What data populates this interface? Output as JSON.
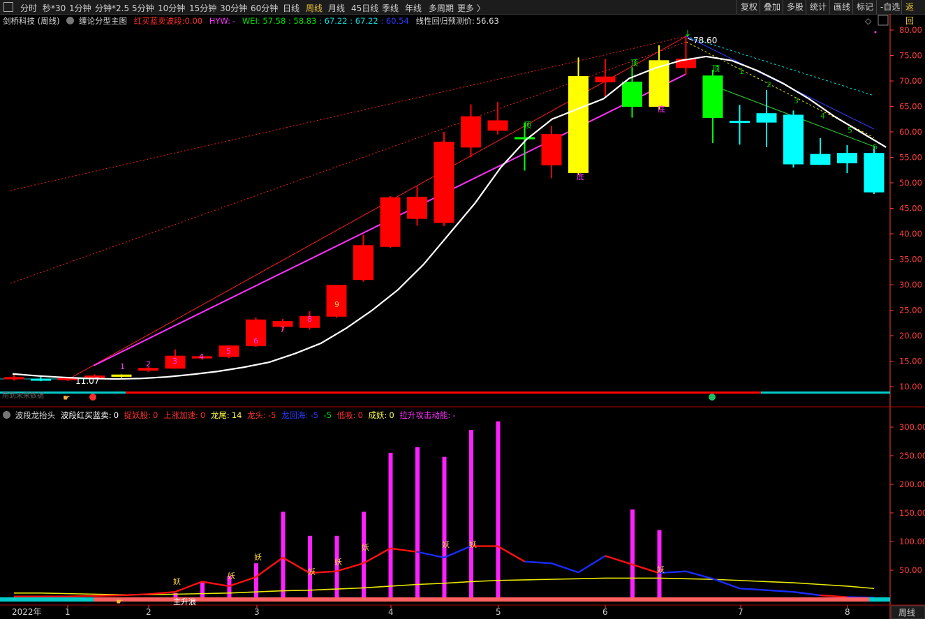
{
  "toolbar": {
    "items": [
      "分时",
      "秒*30",
      "1分钟",
      "分钟*2.5",
      "5分钟",
      "10分钟",
      "15分钟",
      "30分钟",
      "60分钟",
      "日线",
      "周线",
      "月线",
      "45日线",
      "季线",
      "年线",
      "多周期",
      "更多 〉"
    ],
    "active": "周线",
    "right": [
      "复权",
      "叠加",
      "多股",
      "统计",
      "画线",
      "标记",
      "-自选",
      "返回"
    ]
  },
  "main_legend": {
    "stock": "剑桥科技 (周线)",
    "indicator": "缠论分型主图",
    "hmm_label": "红买蓝卖波段:",
    "hmm_value": "0.00",
    "hyw_label": "HYW:",
    "hyw_value": "-",
    "wei_label": "WEI:",
    "wei_v1": "57.58",
    "wei_v2": "58.83",
    "wei_v3": "67.22",
    "wei_v4": "67.22",
    "wei_v5": "60.54",
    "reg_label": "线性回归预测价:",
    "reg_value": "56.63"
  },
  "sub_legend": {
    "indicator": "波段龙抬头",
    "a_label": "波段红买蓝卖:",
    "a_value": "0",
    "b_label": "捉妖股:",
    "b_value": "0",
    "c_label": "上涨加速:",
    "c_value": "0",
    "d_label": "龙尾:",
    "d_value": "14",
    "e_label": "龙头:",
    "e_value": "-5",
    "f_label": "龙回海:",
    "f_value": "-5",
    "g_label": "-5",
    "h_label": "低吸:",
    "h_value": "0",
    "i_label": "成妖:",
    "i_value": "0",
    "j_label": "拉升攻击动能:",
    "j_value": "-"
  },
  "annotations": {
    "max_price": "78.60",
    "min_price": "11.07",
    "top_text": "顶",
    "bottom_text": "底",
    "yao_text": "妖",
    "main_wave": "主升浪",
    "bottom_strip": "用到未来数据"
  },
  "xaxis": {
    "year": "2022年",
    "months": [
      "1",
      "2",
      "3",
      "4",
      "5",
      "6",
      "7",
      "8"
    ],
    "period_button": "周线"
  },
  "colors": {
    "up": "#ff0000",
    "down": "#00ff00",
    "yellow": "#ffff00",
    "cyan": "#00ffff",
    "magenta": "#ff00ff",
    "white": "#ffffff",
    "axis": "#ff3b3b"
  },
  "chart_data": [
    {
      "type": "candlestick",
      "title": "剑桥科技 (周线)",
      "ylim": [
        8,
        82
      ],
      "yticks": [
        10,
        15,
        20,
        25,
        30,
        35,
        40,
        45,
        50,
        55,
        60,
        65,
        70,
        75,
        80
      ],
      "candles": [
        {
          "o": 11.8,
          "h": 12.3,
          "l": 11.2,
          "c": 11.5,
          "color": "up"
        },
        {
          "o": 11.5,
          "h": 11.9,
          "l": 11.07,
          "c": 11.3,
          "color": "cyan"
        },
        {
          "o": 11.3,
          "h": 11.8,
          "l": 11.1,
          "c": 11.6,
          "color": "up"
        },
        {
          "o": 11.6,
          "h": 12.4,
          "l": 11.5,
          "c": 12.1,
          "color": "up"
        },
        {
          "o": 12.0,
          "h": 12.4,
          "l": 11.8,
          "c": 12.3,
          "color": "yellow"
        },
        {
          "o": 13.2,
          "h": 13.9,
          "l": 12.9,
          "c": 13.6,
          "color": "up"
        },
        {
          "o": 13.6,
          "h": 17.3,
          "l": 13.5,
          "c": 16.0,
          "color": "up"
        },
        {
          "o": 15.6,
          "h": 16.3,
          "l": 15.3,
          "c": 15.9,
          "color": "up"
        },
        {
          "o": 15.9,
          "h": 18.1,
          "l": 15.6,
          "c": 18.0,
          "color": "up"
        },
        {
          "o": 18.0,
          "h": 23.6,
          "l": 17.8,
          "c": 23.1,
          "color": "up"
        },
        {
          "o": 21.8,
          "h": 23.3,
          "l": 21.0,
          "c": 22.8,
          "color": "up"
        },
        {
          "o": 21.6,
          "h": 24.8,
          "l": 21.2,
          "c": 23.8,
          "color": "up"
        },
        {
          "o": 23.8,
          "h": 30.0,
          "l": 23.5,
          "c": 29.9,
          "color": "up"
        },
        {
          "o": 31.0,
          "h": 39.8,
          "l": 30.6,
          "c": 37.7,
          "color": "up"
        },
        {
          "o": 37.5,
          "h": 47.4,
          "l": 37.2,
          "c": 47.1,
          "color": "up"
        },
        {
          "o": 43.0,
          "h": 49.3,
          "l": 41.6,
          "c": 47.2,
          "color": "up"
        },
        {
          "o": 42.2,
          "h": 60.0,
          "l": 41.5,
          "c": 58.0,
          "color": "up"
        },
        {
          "o": 57.0,
          "h": 65.4,
          "l": 55.0,
          "c": 63.0,
          "color": "up"
        },
        {
          "o": 60.3,
          "h": 65.9,
          "l": 59.5,
          "c": 62.2,
          "color": "up"
        },
        {
          "o": 58.9,
          "h": 61.8,
          "l": 52.4,
          "c": 58.9,
          "color": "down"
        },
        {
          "o": 53.5,
          "h": 61.2,
          "l": 50.9,
          "c": 59.5,
          "color": "up"
        },
        {
          "o": 52.0,
          "h": 74.6,
          "l": 51.5,
          "c": 70.9,
          "color": "yellow"
        },
        {
          "o": 69.8,
          "h": 74.3,
          "l": 67.0,
          "c": 70.8,
          "color": "up"
        },
        {
          "o": 69.8,
          "h": 72.7,
          "l": 62.8,
          "c": 65.0,
          "color": "down"
        },
        {
          "o": 65.0,
          "h": 77.0,
          "l": 64.4,
          "c": 74.0,
          "color": "yellow"
        },
        {
          "o": 72.6,
          "h": 78.6,
          "l": 71.2,
          "c": 74.3,
          "color": "up"
        },
        {
          "o": 71.0,
          "h": 72.2,
          "l": 57.8,
          "c": 62.8,
          "color": "down"
        },
        {
          "o": 62.1,
          "h": 65.3,
          "l": 57.5,
          "c": 62.1,
          "color": "cyan"
        },
        {
          "o": 63.6,
          "h": 68.2,
          "l": 57.0,
          "c": 61.9,
          "color": "cyan"
        },
        {
          "o": 63.3,
          "h": 64.2,
          "l": 53.0,
          "c": 53.7,
          "color": "cyan"
        },
        {
          "o": 55.6,
          "h": 58.8,
          "l": 53.5,
          "c": 53.6,
          "color": "cyan"
        },
        {
          "o": 55.8,
          "h": 57.4,
          "l": 51.9,
          "c": 53.9,
          "color": "cyan"
        },
        {
          "o": 55.8,
          "h": 57.2,
          "l": 47.8,
          "c": 48.2,
          "color": "cyan"
        }
      ],
      "series": [
        {
          "name": "white_line",
          "values": [
            12.5,
            12.1,
            11.8,
            11.6,
            11.5,
            11.6,
            11.9,
            12.4,
            13.0,
            13.8,
            14.8,
            16.5,
            18.5,
            21.5,
            25.0,
            29.0,
            34.0,
            40.0,
            46.0,
            53.0,
            58.5,
            62.5,
            64.5,
            66.5,
            70.5,
            72.5,
            74.0,
            74.8,
            74.0,
            72.0,
            69.5,
            66.5,
            63.0,
            60.0,
            57.0
          ]
        }
      ]
    },
    {
      "type": "bar",
      "title": "波段龙抬头",
      "ylim": [
        0,
        330
      ],
      "yticks": [
        50,
        100,
        150,
        200,
        250,
        300
      ],
      "magenta_bars": [
        0,
        0,
        0,
        0,
        0,
        0,
        10,
        30,
        40,
        62,
        152,
        110,
        110,
        152,
        255,
        265,
        248,
        295,
        310,
        0,
        0,
        0,
        0,
        156,
        120,
        0,
        0,
        0,
        0,
        0,
        0,
        0,
        0
      ],
      "red_line": [
        4,
        4,
        4,
        5,
        6,
        8,
        12,
        30,
        22,
        38,
        72,
        45,
        48,
        62,
        88,
        82,
        72,
        92,
        92,
        65,
        62,
        46,
        75,
        60,
        45,
        48,
        35,
        18,
        15,
        12,
        6,
        3,
        2
      ],
      "yellow_line": [
        10,
        10,
        9,
        8,
        7,
        7,
        8,
        9,
        10,
        12,
        14,
        15,
        17,
        19,
        22,
        25,
        27,
        30,
        32,
        33,
        34,
        35,
        36,
        36,
        36,
        35,
        34,
        32,
        30,
        28,
        25,
        22,
        18
      ]
    }
  ]
}
